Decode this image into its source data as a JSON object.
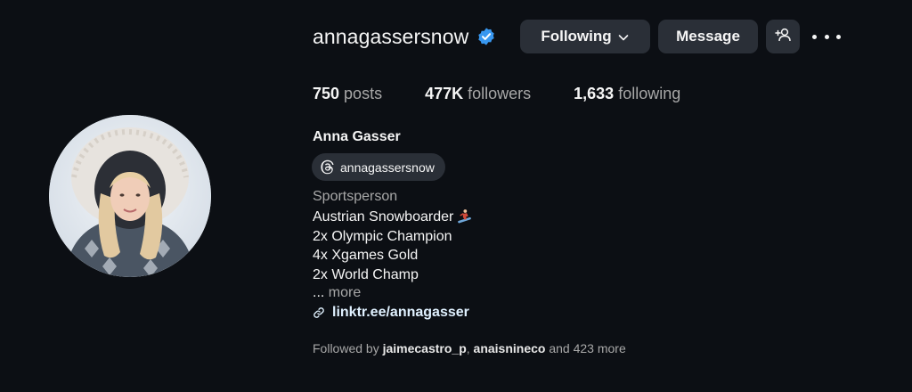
{
  "profile": {
    "username": "annagassersnow",
    "full_name": "Anna Gasser",
    "threads_handle": "annagassersnow",
    "category": "Sportsperson",
    "bio_lines": [
      "Austrian Snowboarder",
      "2x Olympic Champion",
      "4x Xgames Gold",
      "2x World Champ"
    ],
    "bio_emoji": "snowboarder-emoji",
    "more_prefix": "...",
    "more_label": "more",
    "link": "linktr.ee/annagasser"
  },
  "actions": {
    "following_label": "Following",
    "message_label": "Message"
  },
  "stats": {
    "posts_count": "750",
    "posts_label": "posts",
    "followers_count": "477K",
    "followers_label": "followers",
    "following_count": "1,633",
    "following_label": "following"
  },
  "followed_by": {
    "prefix": "Followed by",
    "user1": "jaimecastro_p",
    "separator": ",",
    "user2": "anaisnineco",
    "suffix": "and 423 more"
  },
  "colors": {
    "background": "#0c0f14",
    "button_bg": "#2a2f37",
    "verified_blue": "#3897f0",
    "muted_text": "#a8a8a8"
  },
  "icons": [
    "verified-badge-icon",
    "chevron-down-icon",
    "add-user-icon",
    "more-options-icon",
    "threads-icon",
    "link-icon"
  ]
}
